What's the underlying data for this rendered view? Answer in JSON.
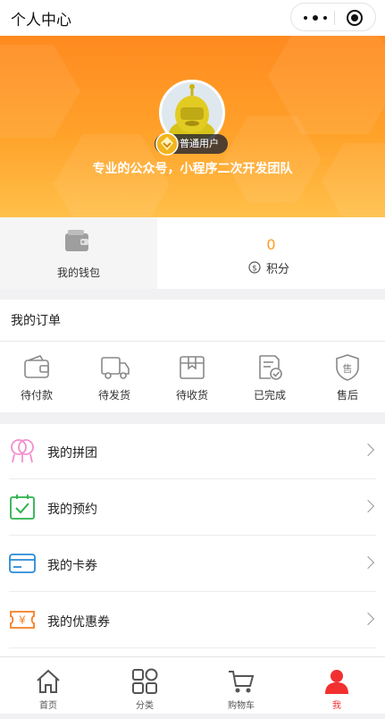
{
  "header": {
    "title": "个人中心"
  },
  "capsule": {
    "more_icon": "more-dots-icon",
    "close_icon": "target-icon"
  },
  "profile": {
    "level_badge": "普通用户",
    "tagline": "专业的公众号，小程序二次开发团队",
    "accent_color": "#ff9a1a"
  },
  "stats": {
    "wallet_label": "我的钱包",
    "points_value": "0",
    "points_label": "积分"
  },
  "orders": {
    "title": "我的订单",
    "items": [
      {
        "label": "待付款",
        "icon": "wallet-outline-icon"
      },
      {
        "label": "待发货",
        "icon": "truck-icon"
      },
      {
        "label": "待收货",
        "icon": "box-icon"
      },
      {
        "label": "已完成",
        "icon": "completed-doc-icon"
      },
      {
        "label": "售后",
        "icon": "shield-after-sale-icon"
      }
    ]
  },
  "menu": [
    {
      "label": "我的拼团",
      "icon": "group-buy-icon",
      "color": "#f28fd0"
    },
    {
      "label": "我的预约",
      "icon": "calendar-check-icon",
      "color": "#2bb24c"
    },
    {
      "label": "我的卡券",
      "icon": "card-icon",
      "color": "#2a8bd6"
    },
    {
      "label": "我的优惠券",
      "icon": "coupon-icon",
      "color": "#f57e22"
    }
  ],
  "tabbar": {
    "active_color": "#f23030",
    "items": [
      {
        "label": "首页",
        "icon": "home-icon"
      },
      {
        "label": "分类",
        "icon": "category-icon"
      },
      {
        "label": "购物车",
        "icon": "cart-icon"
      },
      {
        "label": "我",
        "icon": "user-icon"
      }
    ]
  }
}
